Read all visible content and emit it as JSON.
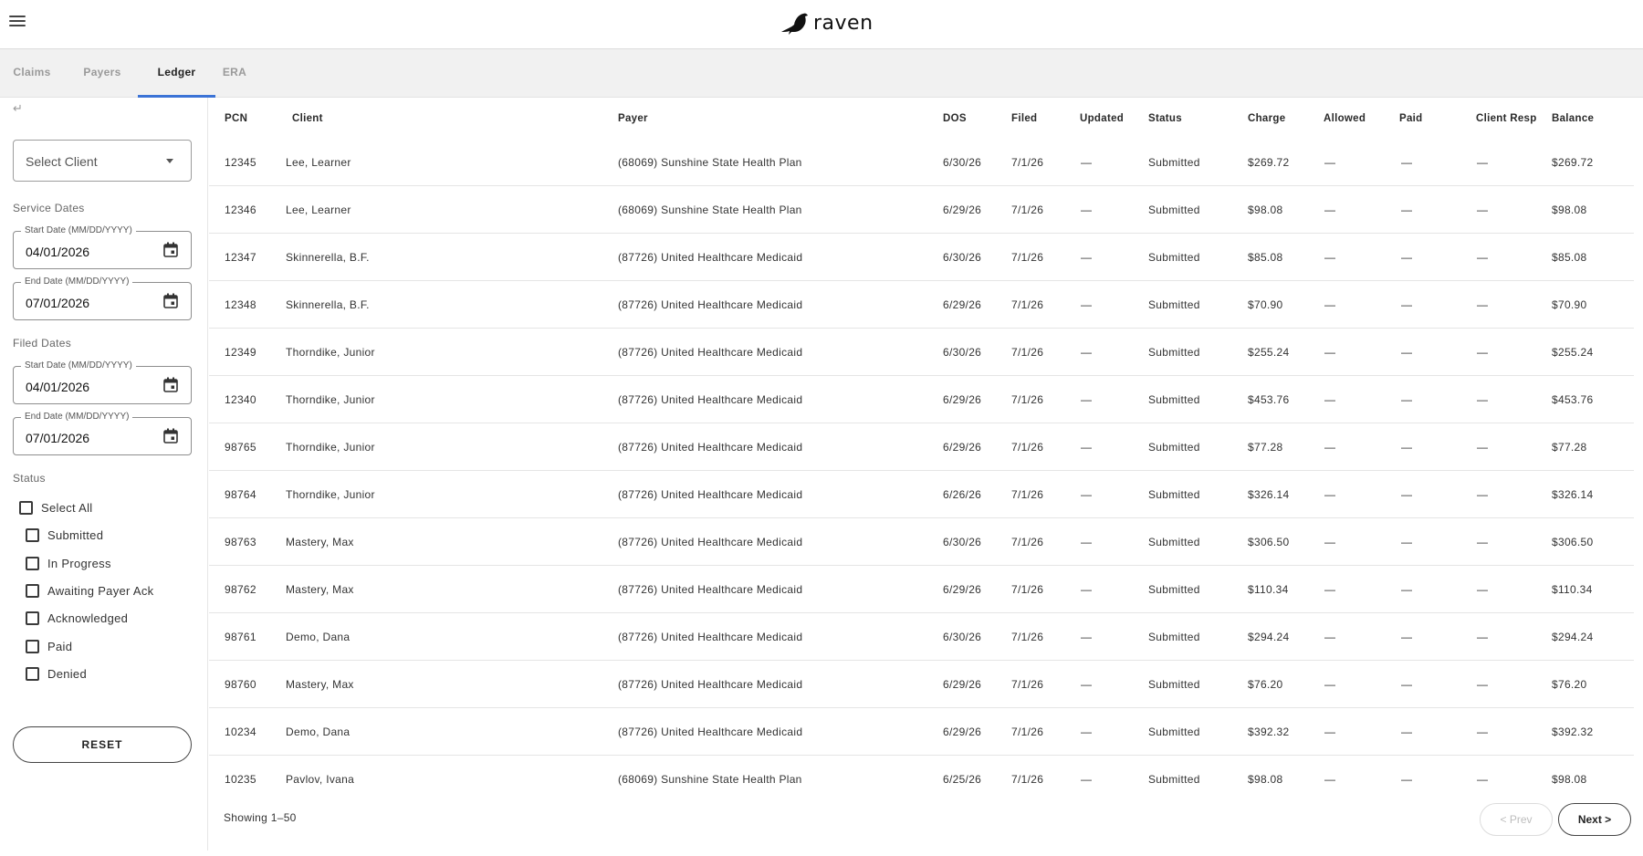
{
  "header": {
    "brand_name": "raven",
    "logo_icon": "raven-bird-icon",
    "menu_icon": "hamburger-menu-icon"
  },
  "tabs": [
    {
      "label": "Claims",
      "active": false
    },
    {
      "label": "Payers",
      "active": false
    },
    {
      "label": "Ledger",
      "active": true
    },
    {
      "label": "ERA",
      "active": false
    }
  ],
  "sidebar": {
    "back_icon": "↵",
    "client_select": {
      "placeholder": "Select Client"
    },
    "service_dates": {
      "label": "Service Dates",
      "start": {
        "legend": "Start Date (MM/DD/YYYY)",
        "value": "04/01/2026"
      },
      "end": {
        "legend": "End Date (MM/DD/YYYY)",
        "value": "07/01/2026"
      }
    },
    "filed_dates": {
      "label": "Filed Dates",
      "start": {
        "legend": "Start Date (MM/DD/YYYY)",
        "value": "04/01/2026"
      },
      "end": {
        "legend": "End Date (MM/DD/YYYY)",
        "value": "07/01/2026"
      }
    },
    "status": {
      "label": "Status",
      "select_all": {
        "label": "Select All",
        "checked": false
      },
      "options": [
        {
          "label": "Submitted",
          "checked": false
        },
        {
          "label": "In Progress",
          "checked": false
        },
        {
          "label": "Awaiting Payer Ack",
          "checked": false
        },
        {
          "label": "Acknowledged",
          "checked": false
        },
        {
          "label": "Paid",
          "checked": false
        },
        {
          "label": "Denied",
          "checked": false
        }
      ]
    },
    "reset_label": "RESET"
  },
  "table": {
    "columns": {
      "pcn": "PCN",
      "client": "Client",
      "payer": "Payer",
      "dos": "DOS",
      "filed": "Filed",
      "updated": "Updated",
      "status": "Status",
      "charge": "Charge",
      "allowed": "Allowed",
      "paid": "Paid",
      "client_resp": "Client Resp",
      "balance": "Balance"
    },
    "rows": [
      {
        "pcn": "12345",
        "client": "Lee, Learner",
        "payer": "(68069) Sunshine State Health Plan",
        "dos": "6/30/26",
        "filed": "7/1/26",
        "updated": "—",
        "status": "Submitted",
        "charge": "$269.72",
        "allowed": "—",
        "paid": "—",
        "client_resp": "—",
        "balance": "$269.72"
      },
      {
        "pcn": "12346",
        "client": "Lee, Learner",
        "payer": "(68069) Sunshine State Health Plan",
        "dos": "6/29/26",
        "filed": "7/1/26",
        "updated": "—",
        "status": "Submitted",
        "charge": "$98.08",
        "allowed": "—",
        "paid": "—",
        "client_resp": "—",
        "balance": "$98.08"
      },
      {
        "pcn": "12347",
        "client": "Skinnerella, B.F.",
        "payer": "(87726) United Healthcare Medicaid",
        "dos": "6/30/26",
        "filed": "7/1/26",
        "updated": "—",
        "status": "Submitted",
        "charge": "$85.08",
        "allowed": "—",
        "paid": "—",
        "client_resp": "—",
        "balance": "$85.08"
      },
      {
        "pcn": "12348",
        "client": "Skinnerella, B.F.",
        "payer": "(87726) United Healthcare Medicaid",
        "dos": "6/29/26",
        "filed": "7/1/26",
        "updated": "—",
        "status": "Submitted",
        "charge": "$70.90",
        "allowed": "—",
        "paid": "—",
        "client_resp": "—",
        "balance": "$70.90"
      },
      {
        "pcn": "12349",
        "client": "Thorndike, Junior",
        "payer": "(87726) United Healthcare Medicaid",
        "dos": "6/30/26",
        "filed": "7/1/26",
        "updated": "—",
        "status": "Submitted",
        "charge": "$255.24",
        "allowed": "—",
        "paid": "—",
        "client_resp": "—",
        "balance": "$255.24"
      },
      {
        "pcn": "12340",
        "client": "Thorndike, Junior",
        "payer": "(87726) United Healthcare Medicaid",
        "dos": "6/29/26",
        "filed": "7/1/26",
        "updated": "—",
        "status": "Submitted",
        "charge": "$453.76",
        "allowed": "—",
        "paid": "—",
        "client_resp": "—",
        "balance": "$453.76"
      },
      {
        "pcn": "98765",
        "client": "Thorndike, Junior",
        "payer": "(87726) United Healthcare Medicaid",
        "dos": "6/29/26",
        "filed": "7/1/26",
        "updated": "—",
        "status": "Submitted",
        "charge": "$77.28",
        "allowed": "—",
        "paid": "—",
        "client_resp": "—",
        "balance": "$77.28"
      },
      {
        "pcn": "98764",
        "client": "Thorndike, Junior",
        "payer": "(87726) United Healthcare Medicaid",
        "dos": "6/26/26",
        "filed": "7/1/26",
        "updated": "—",
        "status": "Submitted",
        "charge": "$326.14",
        "allowed": "—",
        "paid": "—",
        "client_resp": "—",
        "balance": "$326.14"
      },
      {
        "pcn": "98763",
        "client": "Mastery, Max",
        "payer": "(87726) United Healthcare Medicaid",
        "dos": "6/30/26",
        "filed": "7/1/26",
        "updated": "—",
        "status": "Submitted",
        "charge": "$306.50",
        "allowed": "—",
        "paid": "—",
        "client_resp": "—",
        "balance": "$306.50"
      },
      {
        "pcn": "98762",
        "client": "Mastery, Max",
        "payer": "(87726) United Healthcare Medicaid",
        "dos": "6/29/26",
        "filed": "7/1/26",
        "updated": "—",
        "status": "Submitted",
        "charge": "$110.34",
        "allowed": "—",
        "paid": "—",
        "client_resp": "—",
        "balance": "$110.34"
      },
      {
        "pcn": "98761",
        "client": "Demo, Dana",
        "payer": "(87726) United Healthcare Medicaid",
        "dos": "6/30/26",
        "filed": "7/1/26",
        "updated": "—",
        "status": "Submitted",
        "charge": "$294.24",
        "allowed": "—",
        "paid": "—",
        "client_resp": "—",
        "balance": "$294.24"
      },
      {
        "pcn": "98760",
        "client": "Mastery, Max",
        "payer": "(87726) United Healthcare Medicaid",
        "dos": "6/29/26",
        "filed": "7/1/26",
        "updated": "—",
        "status": "Submitted",
        "charge": "$76.20",
        "allowed": "—",
        "paid": "—",
        "client_resp": "—",
        "balance": "$76.20"
      },
      {
        "pcn": "10234",
        "client": "Demo, Dana",
        "payer": "(87726) United Healthcare Medicaid",
        "dos": "6/29/26",
        "filed": "7/1/26",
        "updated": "—",
        "status": "Submitted",
        "charge": "$392.32",
        "allowed": "—",
        "paid": "—",
        "client_resp": "—",
        "balance": "$392.32"
      },
      {
        "pcn": "10235",
        "client": "Pavlov, Ivana",
        "payer": "(68069) Sunshine State Health Plan",
        "dos": "6/25/26",
        "filed": "7/1/26",
        "updated": "—",
        "status": "Submitted",
        "charge": "$98.08",
        "allowed": "—",
        "paid": "—",
        "client_resp": "—",
        "balance": "$98.08"
      }
    ]
  },
  "pagination": {
    "showing": "Showing 1–50",
    "prev_label": "< Prev",
    "next_label": "Next >",
    "prev_disabled": true
  },
  "colors": {
    "accent": "#3b73d6",
    "tab_bar_bg": "#f1f1f1"
  }
}
